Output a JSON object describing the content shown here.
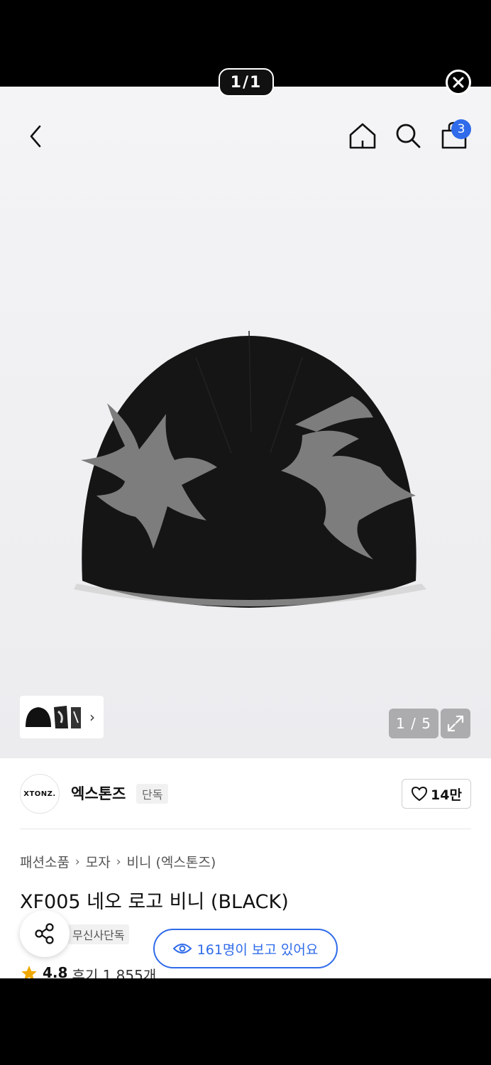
{
  "viewer": {
    "counter": "1/1"
  },
  "gallery": {
    "page_indicator": "1 / 5"
  },
  "header": {
    "cart_count": "3"
  },
  "brand": {
    "logo_text": "XTONZ.",
    "name": "엑스톤즈",
    "tag": "단독"
  },
  "like": {
    "count": "14만"
  },
  "breadcrumb": [
    "패션소품",
    "모자",
    "비니 (엑스톤즈)"
  ],
  "product": {
    "title": "XF005 네오 로고 비니 (BLACK)",
    "exclusive_tag": "무신사단독",
    "viewers": "161명이 보고 있어요",
    "rating": "4.8",
    "reviews": "후기 1,855개"
  },
  "colors": {
    "accent": "#2f6bea",
    "beanie_black": "#151515",
    "pattern_grey": "#7d7d7d"
  }
}
